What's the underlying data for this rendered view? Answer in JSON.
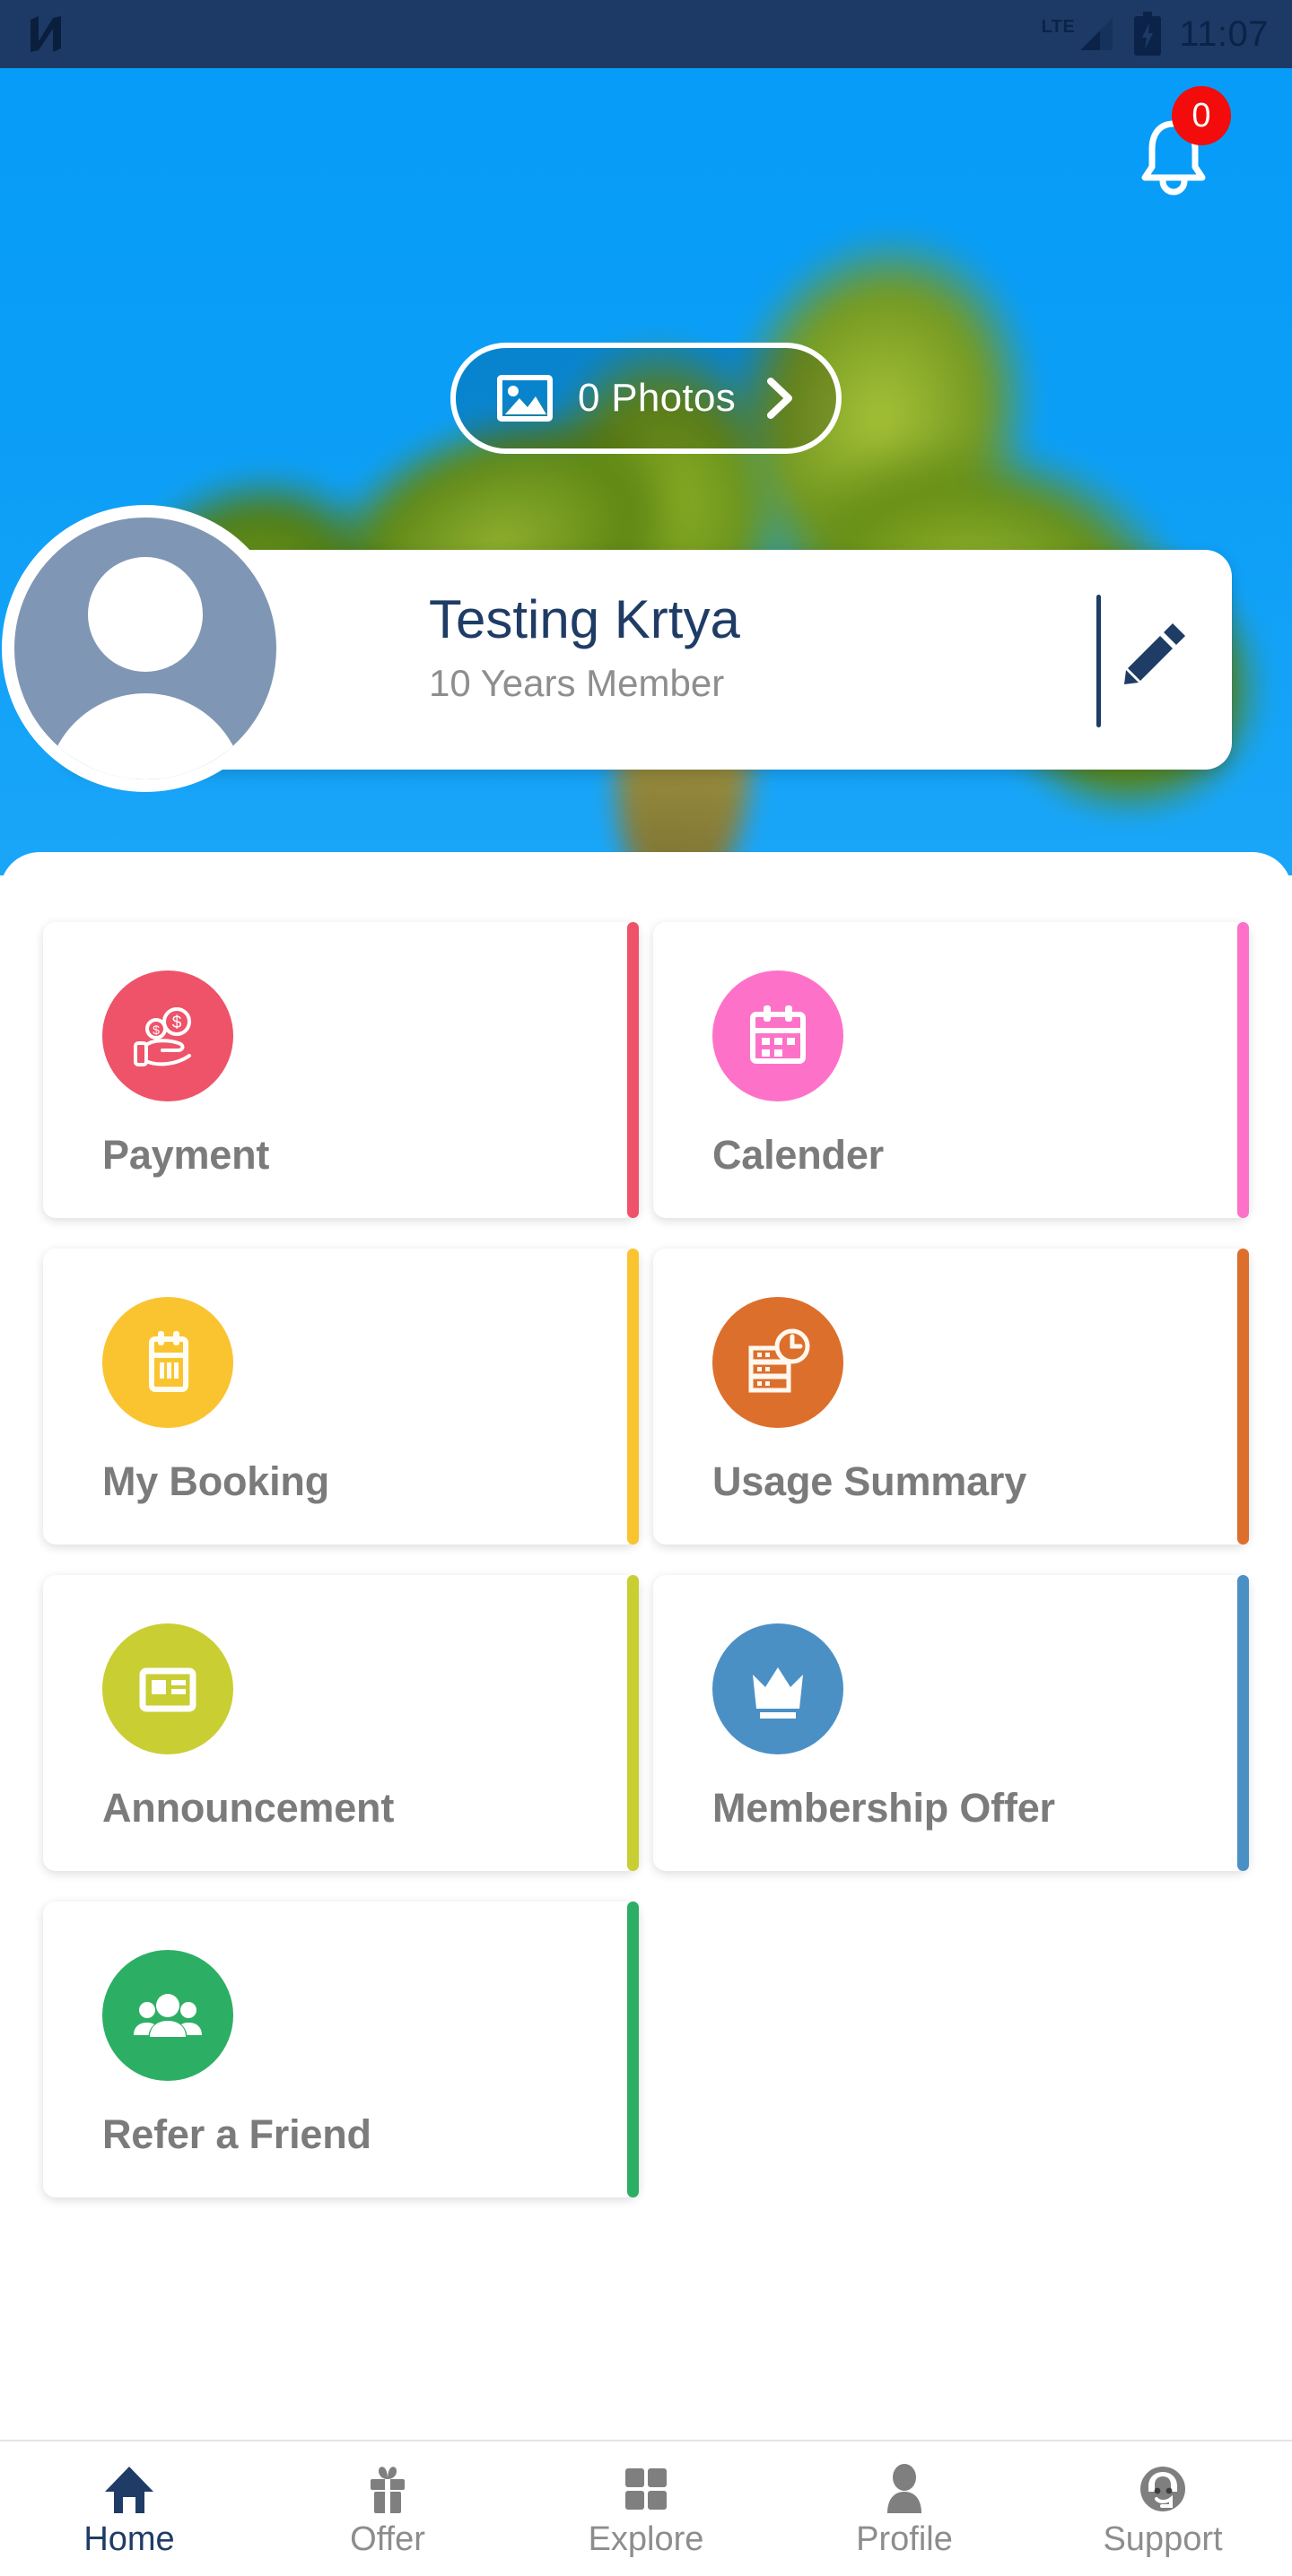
{
  "status_bar": {
    "left_icon": "n-app-logo-icon",
    "network_label": "LTE",
    "signal_icon": "signal-bars-icon",
    "battery_icon": "battery-charging-icon",
    "time": "11:07",
    "background_color": "#1d3a66"
  },
  "hero": {
    "background_description": "blurred palm tree against blue sky",
    "sky_color": "#0b9ef7",
    "notification": {
      "icon": "bell-icon",
      "badge_count": "0",
      "badge_color": "#f40b0b"
    },
    "photos_pill": {
      "icon": "image-icon",
      "label": "0 Photos",
      "chevron": "chevron-right-icon"
    }
  },
  "profile": {
    "avatar_icon": "person-avatar-icon",
    "avatar_color": "#8096b5",
    "name": "Testing Krtya",
    "membership": "10 Years Member",
    "name_color": "#1f3c66",
    "edit_icon": "pencil-edit-icon"
  },
  "tiles": [
    {
      "label": "Payment",
      "icon": "hand-holding-money-icon",
      "color": "#ee5369"
    },
    {
      "label": "Calender",
      "icon": "calendar-icon",
      "color": "#fd72c8"
    },
    {
      "label": "My Booking",
      "icon": "booking-calendar-icon",
      "color": "#fac431"
    },
    {
      "label": "Usage Summary",
      "icon": "server-clock-icon",
      "color": "#dd6f2c"
    },
    {
      "label": "Announcement",
      "icon": "news-article-icon",
      "color": "#c9ce33"
    },
    {
      "label": "Membership Offer",
      "icon": "crown-icon",
      "color": "#4b90c5"
    },
    {
      "label": "Refer a Friend",
      "icon": "people-group-icon",
      "color": "#2caf64"
    }
  ],
  "bottom_nav": {
    "active_color": "#1f3c66",
    "inactive_color": "#8d8d8d",
    "items": [
      {
        "label": "Home",
        "icon": "home-icon",
        "active": true
      },
      {
        "label": "Offer",
        "icon": "gift-icon",
        "active": false
      },
      {
        "label": "Explore",
        "icon": "grid-squares-icon",
        "active": false
      },
      {
        "label": "Profile",
        "icon": "person-icon",
        "active": false
      },
      {
        "label": "Support",
        "icon": "headset-support-icon",
        "active": false
      }
    ]
  }
}
